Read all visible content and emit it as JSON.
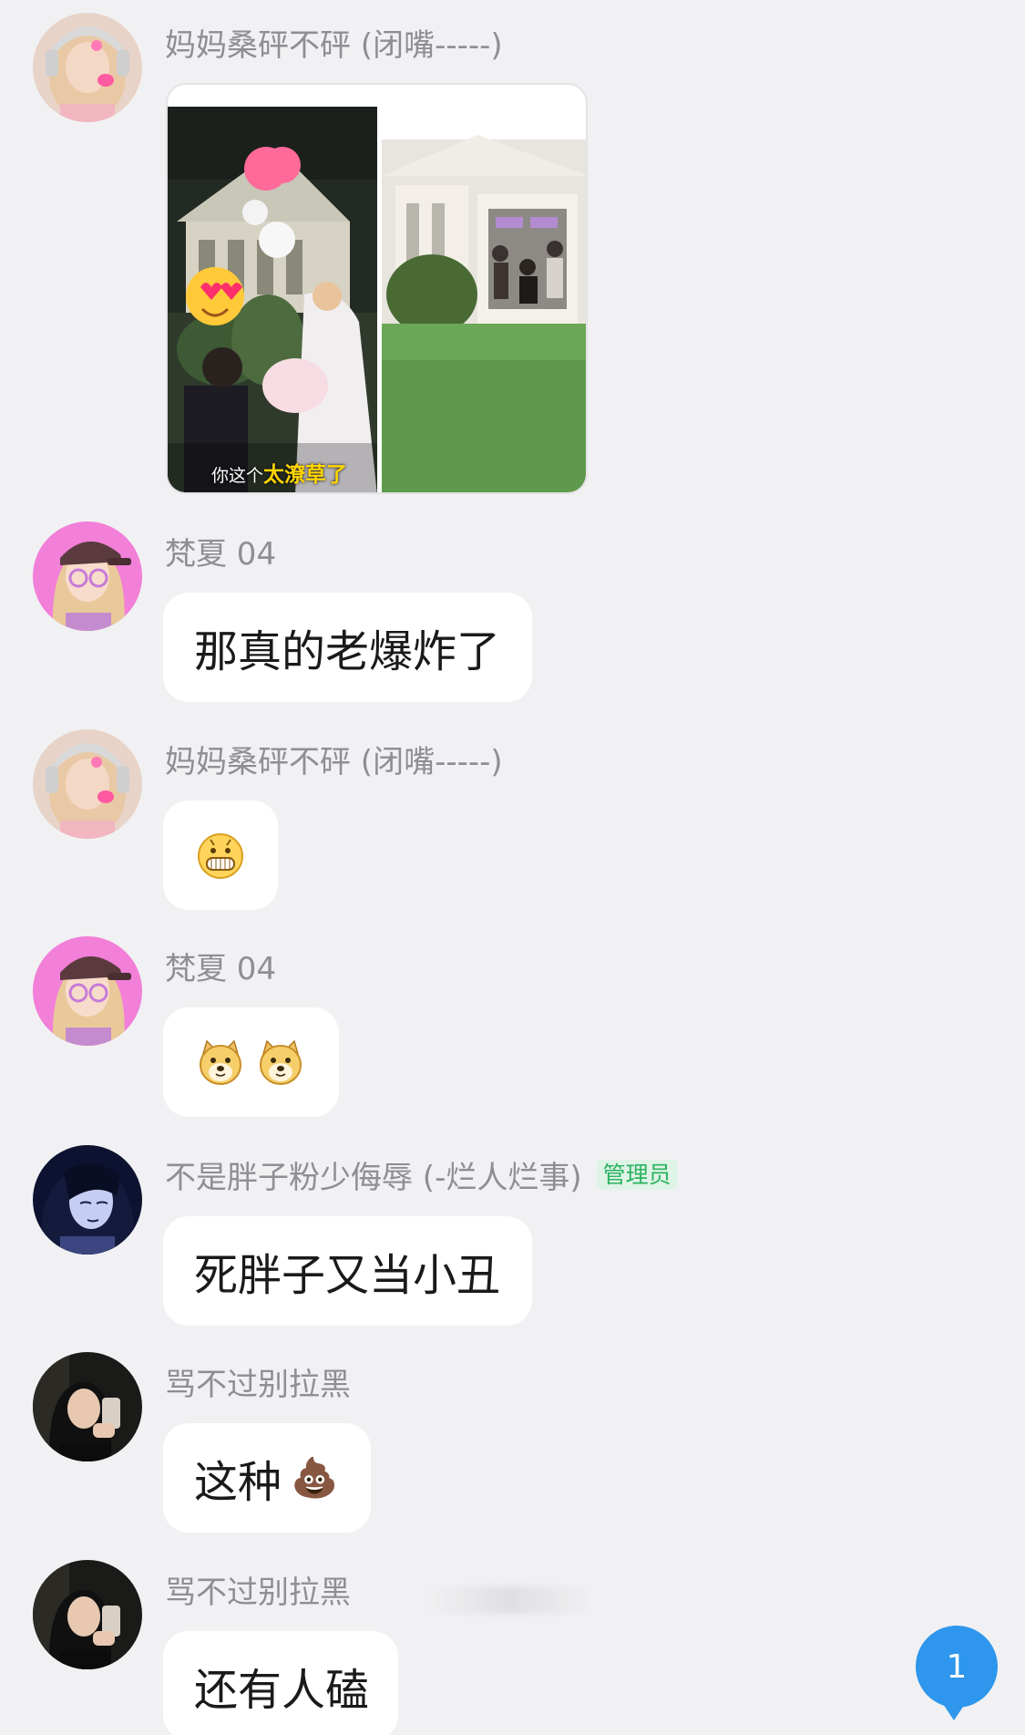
{
  "messages": [
    {
      "sender": "妈妈桑砰不砰 (闭嘴-----)",
      "type": "image",
      "caption_plain": "你这个",
      "caption_highlight": "太潦草了"
    },
    {
      "sender": "梵夏 04",
      "type": "text",
      "text": "那真的老爆炸了"
    },
    {
      "sender": "妈妈桑砰不砰 (闭嘴-----)",
      "type": "emoji",
      "emojis": [
        "grin-emoji"
      ]
    },
    {
      "sender": "梵夏 04",
      "type": "emoji",
      "emojis": [
        "doge-emoji",
        "doge-emoji"
      ]
    },
    {
      "sender": "不是胖子粉少侮辱 (-烂人烂事)",
      "badge": "管理员",
      "type": "text",
      "text": "死胖子又当小丑"
    },
    {
      "sender": "骂不过别拉黑",
      "type": "text",
      "text": "这种",
      "trailing_emoji": "💩"
    },
    {
      "sender": "骂不过别拉黑",
      "type": "text",
      "text": "还有人磕"
    }
  ],
  "unread_count": "1",
  "colors": {
    "background": "#f1f1f3",
    "bubble": "#ffffff",
    "sender_name": "#8e8e93",
    "admin_badge_text": "#2bb361",
    "admin_badge_bg": "#dff3e6",
    "unread_bubble": "#2e96ec"
  }
}
